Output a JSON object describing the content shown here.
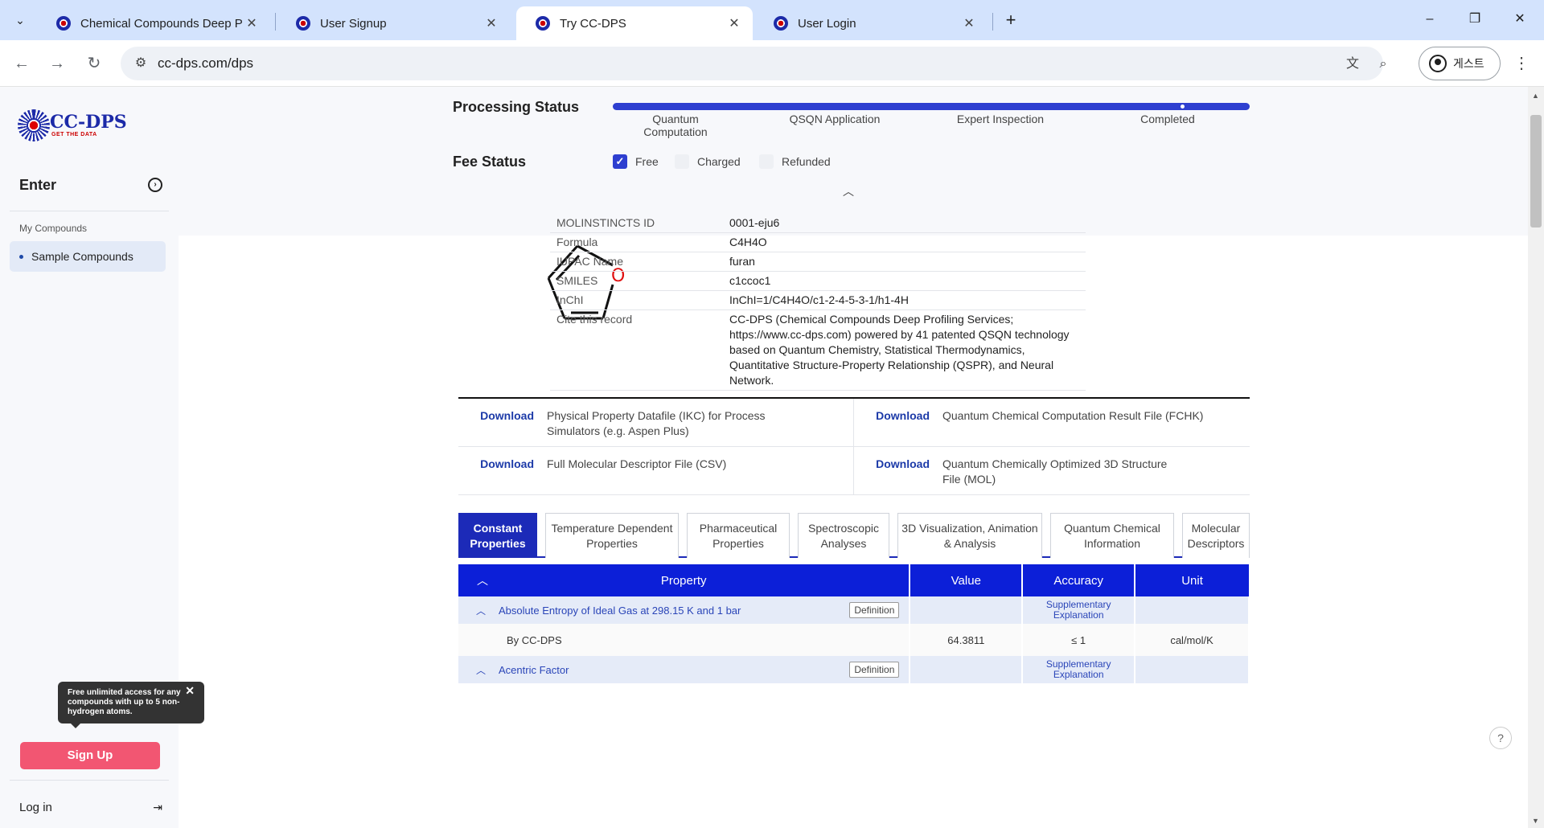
{
  "browser": {
    "tabs": [
      {
        "title": "Chemical Compounds Deep Pr",
        "close": "✕"
      },
      {
        "title": "User Signup",
        "close": "✕"
      },
      {
        "title": "Try CC-DPS",
        "close": "✕"
      },
      {
        "title": "User Login",
        "close": "✕"
      }
    ],
    "url": "cc-dps.com/dps",
    "profile_label": "게스트"
  },
  "sidebar": {
    "logo_text": "CC-DPS",
    "logo_tagline": "GET THE DATA",
    "enter_label": "Enter",
    "section_label": "My Compounds",
    "item_label": "Sample Compounds",
    "tooltip": "Free unlimited access for any compounds with up to 5 non-hydrogen atoms.",
    "signup_label": "Sign Up",
    "login_label": "Log in"
  },
  "status": {
    "processing_title": "Processing Status",
    "steps": [
      "Quantum Computation",
      "QSQN Application",
      "Expert Inspection",
      "Completed"
    ],
    "progress_fraction": 1.0,
    "fee_title": "Fee Status",
    "fee_options": [
      {
        "label": "Free",
        "checked": true
      },
      {
        "label": "Charged",
        "checked": false
      },
      {
        "label": "Refunded",
        "checked": false
      }
    ]
  },
  "compound": {
    "rows": [
      {
        "key": "MOLINSTINCTS ID",
        "value": "0001-eju6"
      },
      {
        "key": "Formula",
        "value": "C4H4O"
      },
      {
        "key": "IUPAC Name",
        "value": "furan"
      },
      {
        "key": "SMILES",
        "value": "c1ccoc1"
      },
      {
        "key": "InChI",
        "value": "InChI=1/C4H4O/c1-2-4-5-3-1/h1-4H"
      },
      {
        "key": "Cite this record",
        "value": "CC-DPS (Chemical Compounds Deep Profiling Services; https://www.cc-dps.com) powered by 41 patented QSQN technology based on Quantum Chemistry, Statistical Thermodynamics, Quantitative Structure-Property Relationship (QSPR), and Neural Network."
      }
    ],
    "hetero_atom": "O"
  },
  "downloads": {
    "link_label": "Download",
    "items": [
      "Physical Property Datafile (IKC) for Process Simulators (e.g. Aspen Plus)",
      "Quantum Chemical Computation Result File (FCHK)",
      "Full Molecular Descriptor File (CSV)",
      "Quantum Chemically Optimized 3D Structure File (MOL)"
    ]
  },
  "property_tabs": [
    "Constant Properties",
    "Temperature Dependent Properties",
    "Pharmaceutical Properties",
    "Spectroscopic Analyses",
    "3D Visualization, Animation & Analysis",
    "Quantum Chemical Information",
    "Molecular Descriptors"
  ],
  "property_table": {
    "headers": {
      "property": "Property",
      "value": "Value",
      "accuracy": "Accuracy",
      "unit": "Unit"
    },
    "definition_label": "Definition",
    "supplementary_label": "Supplementary Explanation",
    "groups": [
      {
        "name": "Absolute Entropy of Ideal Gas at 298.15 K and 1 bar",
        "source": "By CC-DPS",
        "value": "64.3811",
        "accuracy": "≤ 1",
        "unit": "cal/mol/K"
      },
      {
        "name": "Acentric Factor"
      }
    ]
  },
  "help_label": "?"
}
